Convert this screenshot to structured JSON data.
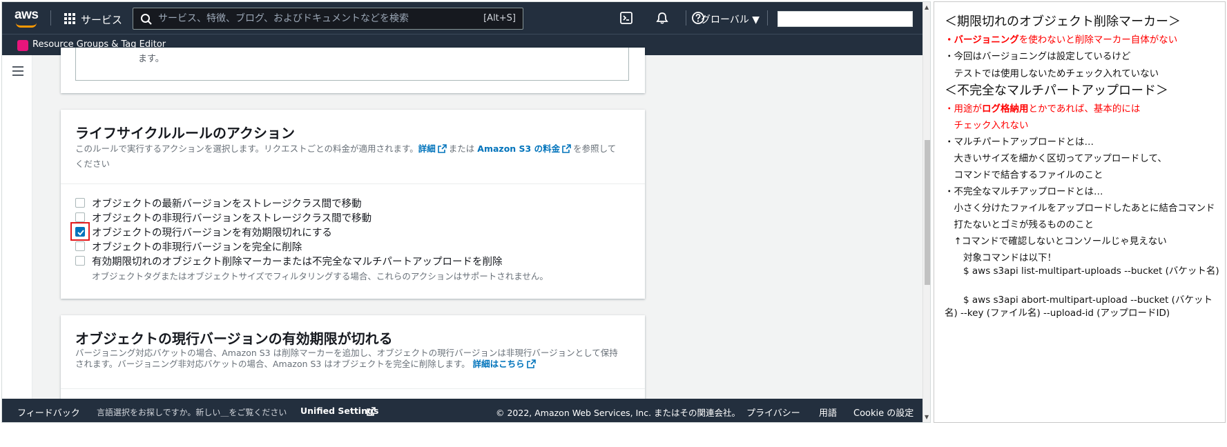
{
  "topnav": {
    "logo": "aws",
    "services_label": "サービス",
    "search": {
      "placeholder": "サービス、特徴、ブログ、およびドキュメントなどを検索",
      "shortcut": "[Alt+S]"
    },
    "icons": [
      "cloudshell-icon",
      "bell-icon",
      "help-icon"
    ],
    "region": "グローバル ▼",
    "account": ""
  },
  "subnav": {
    "service_label": "Resource Groups & Tag Editor"
  },
  "prev_card": {
    "text": "ます。"
  },
  "actions_card": {
    "title": "ライフサイクルルールのアクション",
    "description_pre": "このルールで実行するアクションを選択します。リクエストごとの料金が適用されます。",
    "link1": "詳細",
    "description_mid": "または",
    "link2": "Amazon S3 の料金",
    "description_post": "を参照して",
    "description_line2": "ください",
    "options": [
      {
        "label": "オブジェクトの最新バージョンをストレージクラス間で移動",
        "checked": false
      },
      {
        "label": "オブジェクトの非現行バージョンをストレージクラス間で移動",
        "checked": false
      },
      {
        "label": "オブジェクトの現行バージョンを有効期限切れにする",
        "checked": true
      },
      {
        "label": "オブジェクトの非現行バージョンを完全に削除",
        "checked": false
      },
      {
        "label": "有効期限切れのオブジェクト削除マーカーまたは不完全なマルチパートアップロードを削除",
        "checked": false
      }
    ],
    "note": "オブジェクトタグまたはオブジェクトサイズでフィルタリングする場合、これらのアクションはサポートされません。"
  },
  "expire_card": {
    "title": "オブジェクトの現行バージョンの有効期限が切れる",
    "description_line1": "バージョニング対応バケットの場合、Amazon S3 は削除マーカーを追加し、オブジェクトの現行バージョンは非現行バージョンとして保持",
    "description_line2": "されます。バージョニング非対応バケットの場合、Amazon S3 はオブジェクトを完全に削除します。",
    "link": "詳細はこちら"
  },
  "footer": {
    "feedback": "フィードバック",
    "language_text": "言語選択をお探しですか。新しい＿をご覧ください",
    "unified_settings": "Unified Settings",
    "copyright": "© 2022, Amazon Web Services, Inc. またはその関連会社。",
    "privacy": "プライバシー",
    "terms": "用語",
    "cookie": "Cookie の設定"
  },
  "notes": {
    "h1": "＜期限切れのオブジェクト削除マーカー＞",
    "r1_bold": "・バージョニング",
    "r1_rest": "を使わないと削除マーカー自体がない",
    "n1": "・今回はバージョニングは設定しているけど",
    "n2": "　テストでは使用しないためチェック入れていない",
    "h2": "＜不完全なマルチパートアップロード＞",
    "r2_pre": "・用途が",
    "r2_bold": "ログ格納用",
    "r2_rest": "とかであれば、基本的には",
    "r3": "　チェック入れない",
    "n3": "・マルチパートアップロードとは…",
    "n4": "　大きいサイズを細かく区切ってアップロードして、",
    "n5": "　コマンドで結合するファイルのこと",
    "n6": "・不完全なマルチアップロードとは…",
    "n7": "　小さく分けたファイルをアップロードしたあとに結合コマンド",
    "n8": "　打たないとゴミが残るもののこと",
    "n9": "　↑コマンドで確認しないとコンソールじゃ見えない",
    "n10": "　　対象コマンドは以下！",
    "cmd1": "　　$ aws s3api list-multipart-uploads --bucket (バケット名)",
    "cmd2": "　　$ aws s3api abort-multipart-upload --bucket (バケット名) --key (ファイル名) --upload-id (アップロードID)"
  }
}
